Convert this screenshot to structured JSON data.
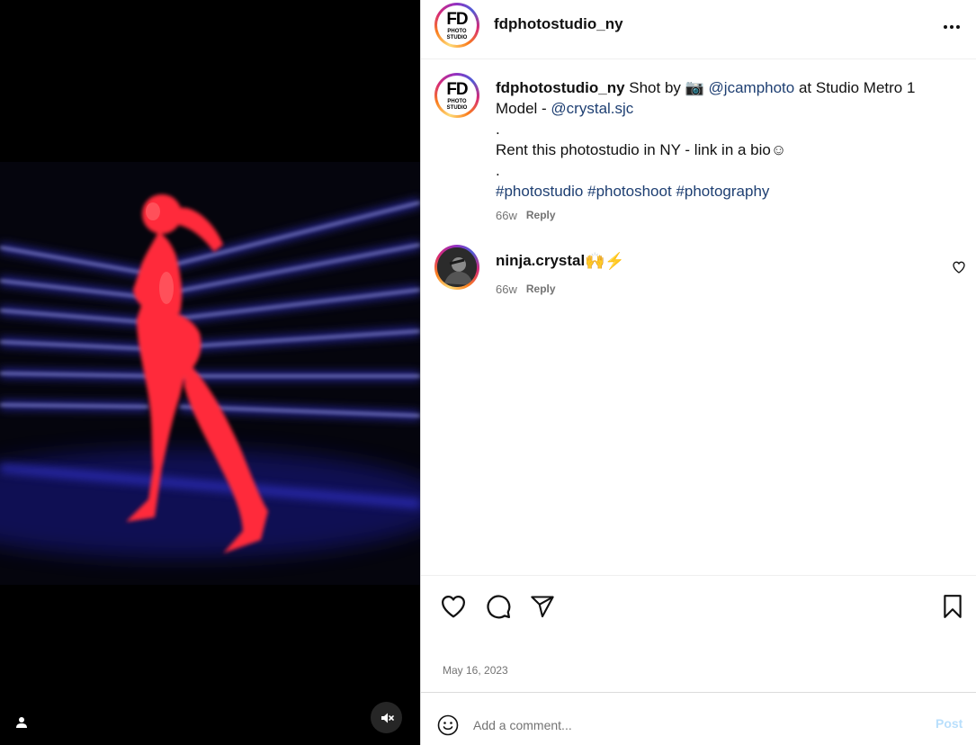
{
  "post": {
    "author": "fdphotostudio_ny",
    "avatar_logo": {
      "big": "FD",
      "line1": "PHOTO",
      "line2": "STUDIO"
    },
    "caption": {
      "shot_by": " Shot by ",
      "camera_emoji": "📷",
      "mention_photographer": "@jcamphoto",
      "at_studio": " at Studio Metro 1",
      "model_prefix": "Model - ",
      "mention_model": "@crystal.sjc",
      "dot1": ".",
      "rent_line": "Rent this photostudio in NY - link in a bio☺",
      "dot2": ".",
      "hashtags": [
        "#photostudio",
        "#photoshoot",
        "#photography"
      ],
      "age": "66w",
      "reply_label": "Reply"
    },
    "comments": [
      {
        "user": "ninja.crystal",
        "text": "🙌⚡",
        "age": "66w",
        "reply_label": "Reply"
      }
    ],
    "date": "May 16, 2023"
  },
  "composer": {
    "placeholder": "Add a comment...",
    "post_label": "Post"
  },
  "icons": {
    "header_more": "more-horizontal-icon",
    "like": "heart-icon",
    "comment": "comment-icon",
    "share": "send-icon",
    "save": "bookmark-icon",
    "emoji": "emoji-icon",
    "tag": "user-tag-icon",
    "mute": "muted-speaker-icon"
  },
  "colors": {
    "link": "#1e3f72",
    "post_button_disabled": "#b9dffc",
    "muted_text": "#737373"
  }
}
